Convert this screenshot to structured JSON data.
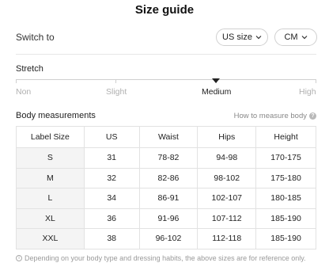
{
  "title": "Size guide",
  "switch": {
    "label": "Switch to",
    "size_system": "US size",
    "unit": "CM"
  },
  "stretch": {
    "title": "Stretch",
    "levels": [
      "Non",
      "Slight",
      "Medium",
      "High"
    ],
    "selected": "Medium"
  },
  "body_measurements": {
    "title": "Body measurements",
    "how_to_link": "How to measure body"
  },
  "table": {
    "headers": [
      "Label Size",
      "US",
      "Waist",
      "Hips",
      "Height"
    ],
    "rows": [
      [
        "S",
        "31",
        "78-82",
        "94-98",
        "170-175"
      ],
      [
        "M",
        "32",
        "82-86",
        "98-102",
        "175-180"
      ],
      [
        "L",
        "34",
        "86-91",
        "102-107",
        "180-185"
      ],
      [
        "XL",
        "36",
        "91-96",
        "107-112",
        "185-190"
      ],
      [
        "XXL",
        "38",
        "96-102",
        "112-118",
        "185-190"
      ]
    ]
  },
  "footnote": "Depending on your body type and dressing habits, the above sizes are for reference only.",
  "colors": {
    "text": "#222222",
    "muted": "#b0b0b0",
    "first_col_bg": "#f4f4f4",
    "border": "#e2e2e2"
  },
  "icons": {
    "dropdown": "chevron-down-icon",
    "help": "question-icon",
    "info": "info-icon"
  }
}
